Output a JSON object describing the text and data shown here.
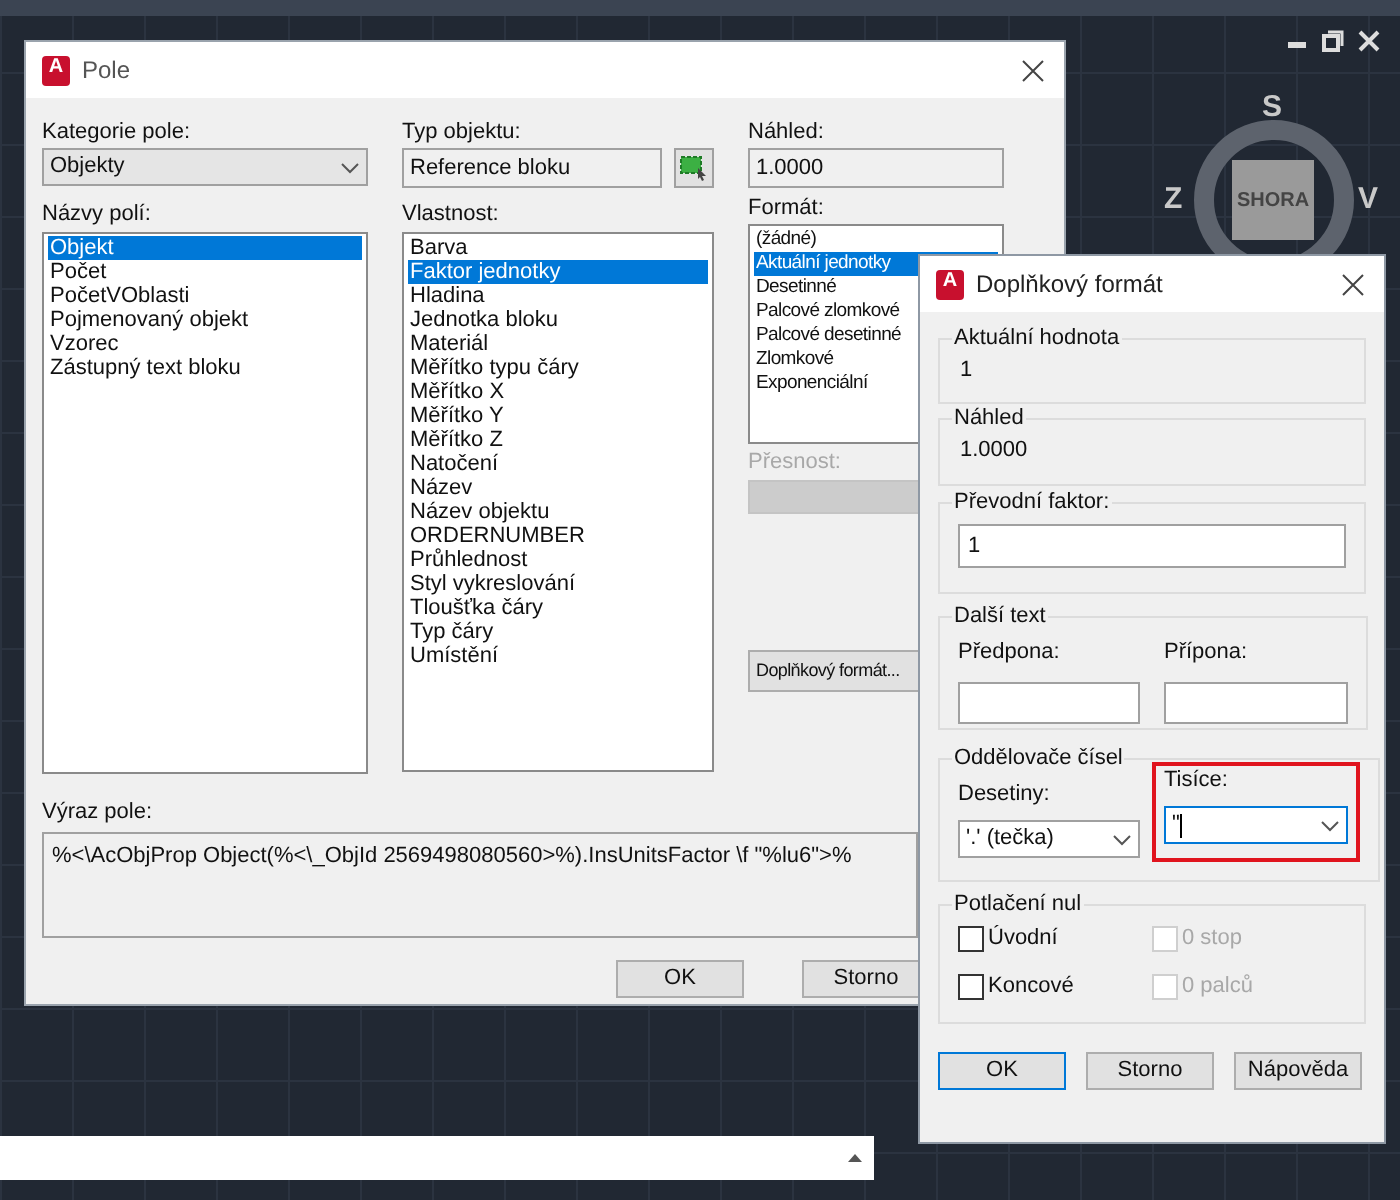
{
  "nav_cube": {
    "top_face": "SHORA",
    "north": "S",
    "west": "Z",
    "east": "V"
  },
  "main_dialog": {
    "logo_letter": "A",
    "title": "Pole",
    "category_label": "Kategorie pole:",
    "category_value": "Objekty",
    "field_names_label": "Názvy polí:",
    "field_names": [
      {
        "label": "Objekt",
        "selected": true
      },
      {
        "label": "Počet",
        "selected": false
      },
      {
        "label": "PočetVOblasti",
        "selected": false
      },
      {
        "label": "Pojmenovaný objekt",
        "selected": false
      },
      {
        "label": "Vzorec",
        "selected": false
      },
      {
        "label": "Zástupný text bloku",
        "selected": false
      }
    ],
    "object_type_label": "Typ objektu:",
    "object_type_value": "Reference bloku",
    "property_label": "Vlastnost:",
    "properties": [
      {
        "label": "Barva",
        "selected": false
      },
      {
        "label": "Faktor jednotky",
        "selected": true
      },
      {
        "label": "Hladina",
        "selected": false
      },
      {
        "label": "Jednotka bloku",
        "selected": false
      },
      {
        "label": "Materiál",
        "selected": false
      },
      {
        "label": "Měřítko typu čáry",
        "selected": false
      },
      {
        "label": "Měřítko X",
        "selected": false
      },
      {
        "label": "Měřítko Y",
        "selected": false
      },
      {
        "label": "Měřítko Z",
        "selected": false
      },
      {
        "label": "Natočení",
        "selected": false
      },
      {
        "label": "Název",
        "selected": false
      },
      {
        "label": "Název objektu",
        "selected": false
      },
      {
        "label": "ORDERNUMBER",
        "selected": false
      },
      {
        "label": "Průhlednost",
        "selected": false
      },
      {
        "label": "Styl vykreslování",
        "selected": false
      },
      {
        "label": "Tloušťka čáry",
        "selected": false
      },
      {
        "label": "Typ čáry",
        "selected": false
      },
      {
        "label": "Umístění",
        "selected": false
      }
    ],
    "preview_label": "Náhled:",
    "preview_value": "1.0000",
    "format_label": "Formát:",
    "formats": [
      {
        "label": "(žádné)",
        "selected": false
      },
      {
        "label": "Aktuální jednotky",
        "selected": true
      },
      {
        "label": "Desetinné",
        "selected": false
      },
      {
        "label": "Palcové zlomkové",
        "selected": false
      },
      {
        "label": "Palcové desetinné",
        "selected": false
      },
      {
        "label": "Zlomkové",
        "selected": false
      },
      {
        "label": "Exponenciální",
        "selected": false
      }
    ],
    "precision_label": "Přesnost:",
    "precision_disabled": true,
    "more_format_button": "Doplňkový formát...",
    "expression_label": "Výraz pole:",
    "expression": "%<\\AcObjProp Object(%<\\_ObjId 2569498080560>%).InsUnitsFactor \\f \"%lu6\">%",
    "buttons": [
      "OK",
      "Storno"
    ]
  },
  "format_dialog": {
    "logo_letter": "A",
    "title": "Doplňkový formát",
    "current_value_label": "Aktuální hodnota",
    "current_value": "1",
    "preview_label": "Náhled",
    "preview_value": "1.0000",
    "conversion_label": "Převodní faktor:",
    "conversion_value": "1",
    "additional_text_label": "Další text",
    "prefix_label": "Předpona:",
    "suffix_label": "Přípona:",
    "separators_label": "Oddělovače čísel",
    "decimal_label": "Desetiny:",
    "decimal_value": "'.' (tečka)",
    "thousands_label": "Tisíce:",
    "thousands_value": "\"",
    "thousands_highlighted": true,
    "zero_label": "Potlačení nul",
    "checkboxes": [
      {
        "label": "Úvodní",
        "checked": false,
        "disabled": false
      },
      {
        "label": "0 stop",
        "checked": false,
        "disabled": true
      },
      {
        "label": "Koncové",
        "checked": false,
        "disabled": false
      },
      {
        "label": "0 palců",
        "checked": false,
        "disabled": true
      }
    ],
    "buttons": [
      {
        "label": "OK",
        "default": true
      },
      {
        "label": "Storno",
        "default": false
      },
      {
        "label": "Nápověda",
        "default": false
      }
    ]
  }
}
